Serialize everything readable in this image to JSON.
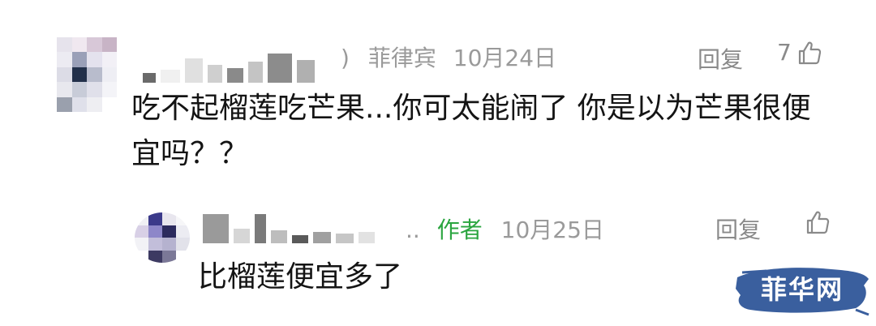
{
  "comment": {
    "location_prefix": ")",
    "location": "菲律宾",
    "date": "10月24日",
    "reply_label": "回复",
    "like_count": "7",
    "text": "吃不起榴莲吃芒果...你可太能闹了  你是以为芒果很便宜吗？？"
  },
  "reply": {
    "name_suffix": "..",
    "author_badge": "作者",
    "date": "10月25日",
    "reply_label": "回复",
    "text": "比榴莲便宜多了"
  },
  "watermark": {
    "text": "菲华网"
  },
  "colors": {
    "author_green": "#2aa53f",
    "meta_gray": "#9a9a9a",
    "watermark_blue": "#3a5f9e"
  }
}
